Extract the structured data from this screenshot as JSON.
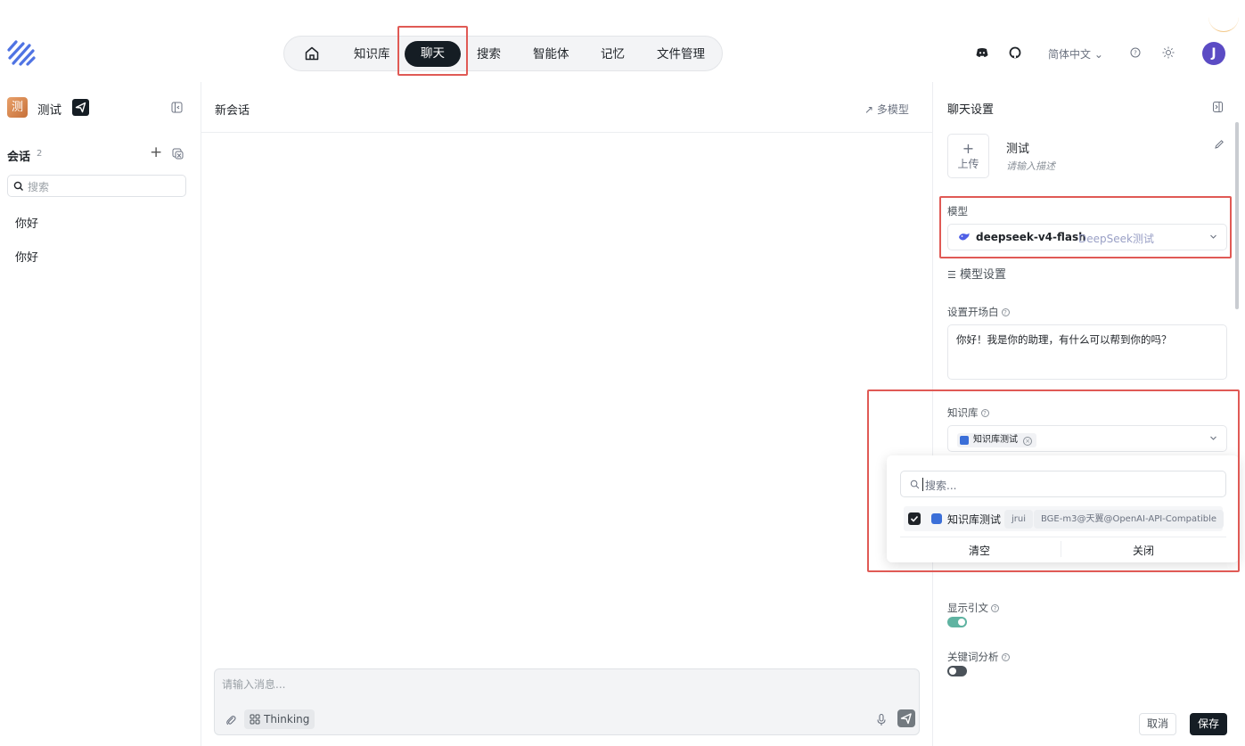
{
  "colors": {
    "accent_dark": "#151d24",
    "highlight_box": "#e05a55",
    "toggle_on": "#5fb3a1",
    "toggle_off": "#4b5259",
    "avatar_bg": "#5b4bc4"
  },
  "nav": {
    "home_icon": "home-icon",
    "items": [
      "知识库",
      "聊天",
      "搜索",
      "智能体",
      "记忆",
      "文件管理"
    ],
    "active": "聊天"
  },
  "top_right": {
    "icons": [
      "discord-icon",
      "github-icon",
      "help-icon",
      "theme-sun-icon"
    ],
    "language": "简体中文",
    "avatar_letter": "J"
  },
  "sidebar": {
    "workspace_badge": "测",
    "workspace_name": "测试",
    "sessions_title": "会话",
    "sessions_count": "2",
    "add_label": "+",
    "search_placeholder": "搜索",
    "sessions": [
      "你好",
      "你好"
    ]
  },
  "chat": {
    "title": "新会话",
    "multi_model": "↗ 多模型",
    "input_placeholder": "请输入消息...",
    "thinking_label": "Thinking"
  },
  "panel": {
    "title": "聊天设置",
    "upload_plus": "+",
    "upload_label": "上传",
    "agent_name": "测试",
    "agent_desc_placeholder": "请输入描述",
    "model_label": "模型",
    "model_name": "deepseek-v4-flash",
    "model_provider": "DeepSeek测试",
    "model_settings_icon": "list-settings-icon",
    "model_settings": "模型设置",
    "opening_label": "设置开场白",
    "opening_value": "你好！我是你的助理，有什么可以帮到你的吗？",
    "kb_label": "知识库",
    "kb_selected_tag": "知识库测试",
    "dropdown": {
      "search_placeholder": "搜索...",
      "option_name": "知识库测试",
      "option_owner": "jrui",
      "option_embedding": "BGE-m3@天翼@OpenAI-API-Compatible",
      "option_checked": true,
      "clear_label": "清空",
      "close_label": "关闭"
    },
    "show_citation_label": "显示引文",
    "show_citation_on": true,
    "keyword_label": "关键词分析",
    "keyword_on": false,
    "cancel_label": "取消",
    "save_label": "保存"
  }
}
